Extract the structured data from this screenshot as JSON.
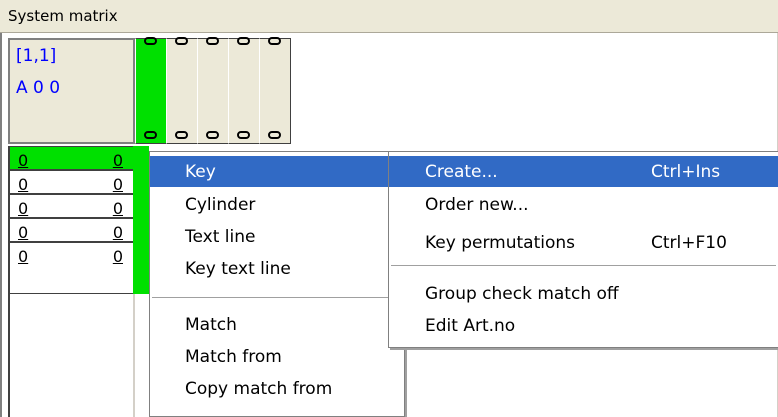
{
  "window": {
    "title": "System matrix"
  },
  "corner": {
    "coord": "[1,1]",
    "code": "A 0 0"
  },
  "rows": [
    {
      "left": "0",
      "right": "0"
    },
    {
      "left": "0",
      "right": "0"
    },
    {
      "left": "0",
      "right": "0"
    },
    {
      "left": "0",
      "right": "0"
    },
    {
      "left": "0",
      "right": "0"
    }
  ],
  "context_menu": {
    "items": [
      {
        "label": "Key"
      },
      {
        "label": "Cylinder"
      },
      {
        "label": "Text line"
      },
      {
        "label": "Key text line"
      },
      {
        "label": "Match"
      },
      {
        "label": "Match from"
      },
      {
        "label": "Copy match from"
      }
    ]
  },
  "submenu": {
    "items": [
      {
        "label": "Create...",
        "shortcut": "Ctrl+Ins"
      },
      {
        "label": "Order new...",
        "shortcut": ""
      },
      {
        "label": "Key permutations",
        "shortcut": "Ctrl+F10"
      },
      {
        "label": "Group check match off",
        "shortcut": ""
      },
      {
        "label": "Edit Art.no",
        "shortcut": ""
      }
    ]
  },
  "colors": {
    "selected_key": "#00e000",
    "highlight": "#316ac5",
    "coord_text": "#0000ff"
  }
}
